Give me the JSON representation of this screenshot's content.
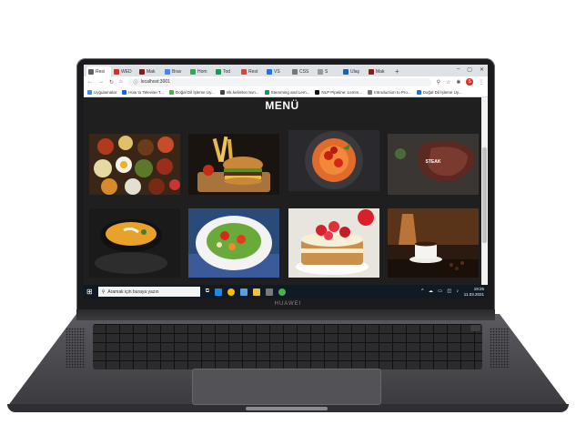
{
  "device": {
    "brand": "HUAWEI"
  },
  "browser": {
    "tabs": [
      {
        "label": "Resi",
        "favicon_color": "#5f6368",
        "active": true
      },
      {
        "label": "WED",
        "favicon_color": "#d93025",
        "active": false
      },
      {
        "label": "Mak",
        "favicon_color": "#8b1a1a",
        "active": false
      },
      {
        "label": "Brav",
        "favicon_color": "#4285f4",
        "active": false
      },
      {
        "label": "Hom",
        "favicon_color": "#34a853",
        "active": false
      },
      {
        "label": "Tod",
        "favicon_color": "#0f9d58",
        "active": false
      },
      {
        "label": "Rest",
        "favicon_color": "#db4437",
        "active": false
      },
      {
        "label": "VS",
        "favicon_color": "#1a73e8",
        "active": false
      },
      {
        "label": "CSS",
        "favicon_color": "#777777",
        "active": false
      },
      {
        "label": "S",
        "favicon_color": "#999999",
        "active": false
      },
      {
        "label": "Ulaş",
        "favicon_color": "#1565c0",
        "active": false
      },
      {
        "label": "Mak",
        "favicon_color": "#8b1a1a",
        "active": false
      }
    ],
    "new_tab_label": "+",
    "window_controls": {
      "minimize": "–",
      "maximize": "▢",
      "close": "✕"
    },
    "url": "localhost:3001",
    "profile_initial": "S",
    "bookmarks": [
      {
        "label": "Uygulamalar",
        "favicon_color": "#4285f4"
      },
      {
        "label": "How to Televise T...",
        "favicon_color": "#0f62fe"
      },
      {
        "label": "Doğal Dil İşleme Uy...",
        "favicon_color": "#4caf50"
      },
      {
        "label": "nlk.kelimler.mvn...",
        "favicon_color": "#444444"
      },
      {
        "label": "Stemming and Lem...",
        "favicon_color": "#00a651"
      },
      {
        "label": "NLP Pipeline: Lemm...",
        "favicon_color": "#111111"
      },
      {
        "label": "Introduction to Pro...",
        "favicon_color": "#777777"
      },
      {
        "label": "Doğal Dil İşleme Uy...",
        "favicon_color": "#1a73e8"
      }
    ]
  },
  "page": {
    "title": "MENÜ",
    "items": [
      {
        "label": "",
        "kind": "breakfast"
      },
      {
        "label": "",
        "kind": "burger"
      },
      {
        "label": "",
        "kind": "spaghetti"
      },
      {
        "label": "STEAK",
        "kind": "steak"
      },
      {
        "label": "",
        "kind": "soup"
      },
      {
        "label": "",
        "kind": "salad"
      },
      {
        "label": "",
        "kind": "cake"
      },
      {
        "label": "",
        "kind": "coffee"
      }
    ]
  },
  "taskbar": {
    "search_placeholder": "Aramak için buraya yazın",
    "tray_icons": "^ ☁ ▭ ◫ ♪",
    "time": "19:25",
    "date": "11.03.2021"
  }
}
